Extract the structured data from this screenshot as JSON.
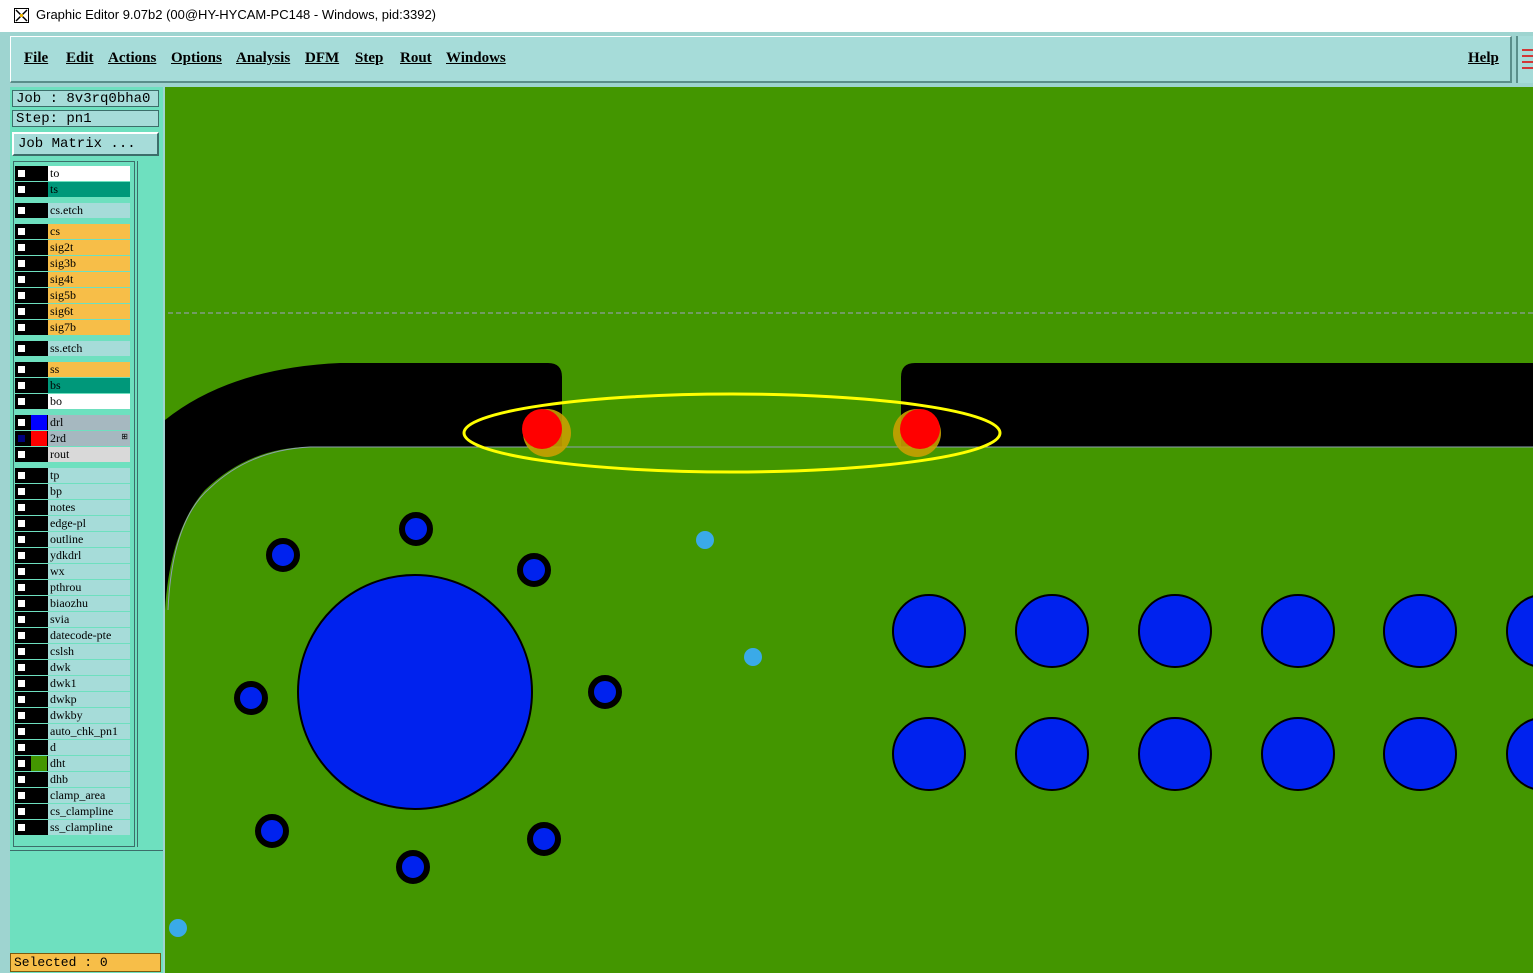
{
  "window": {
    "title": "Graphic Editor 9.07b2 (00@HY-HYCAM-PC148 - Windows, pid:3392)"
  },
  "menu": {
    "items": [
      "File",
      "Edit",
      "Actions",
      "Options",
      "Analysis",
      "DFM",
      "Step",
      "Rout",
      "Windows"
    ],
    "help": "Help"
  },
  "job": {
    "label": "Job : 8v3rq0bha0",
    "step": "Step: pn1",
    "matrix_button": "Job Matrix ..."
  },
  "layers": [
    {
      "name": "to",
      "color": "#ffffff",
      "swatch": "#000000"
    },
    {
      "name": "ts",
      "color": "#00987a",
      "swatch": "#000000"
    },
    {
      "name": "cs.etch",
      "color": "#a6dcd9",
      "swatch": "#000000"
    },
    {
      "name": "cs",
      "color": "#f7be48",
      "swatch": "#000000"
    },
    {
      "name": "sig2t",
      "color": "#f7be48",
      "swatch": "#000000"
    },
    {
      "name": "sig3b",
      "color": "#f7be48",
      "swatch": "#000000"
    },
    {
      "name": "sig4t",
      "color": "#f7be48",
      "swatch": "#000000"
    },
    {
      "name": "sig5b",
      "color": "#f7be48",
      "swatch": "#000000"
    },
    {
      "name": "sig6t",
      "color": "#f7be48",
      "swatch": "#000000"
    },
    {
      "name": "sig7b",
      "color": "#f7be48",
      "swatch": "#000000"
    },
    {
      "name": "ss.etch",
      "color": "#a6dcd9",
      "swatch": "#000000"
    },
    {
      "name": "ss",
      "color": "#f7be48",
      "swatch": "#000000"
    },
    {
      "name": "bs",
      "color": "#00987a",
      "swatch": "#000000"
    },
    {
      "name": "bo",
      "color": "#ffffff",
      "swatch": "#000000"
    },
    {
      "name": "drl",
      "color": "#a6b8c0",
      "swatch": "#0000ff"
    },
    {
      "name": "2rd",
      "color": "#a6b8c0",
      "swatch": "#ff0000",
      "checked": true,
      "mark": "⊞"
    },
    {
      "name": "rout",
      "color": "#d9d9d9",
      "swatch": "#000000"
    },
    {
      "name": "tp",
      "color": "#a6dcd9",
      "swatch": "#000000"
    },
    {
      "name": "bp",
      "color": "#a6dcd9",
      "swatch": "#000000"
    },
    {
      "name": "notes",
      "color": "#a6dcd9",
      "swatch": "#000000"
    },
    {
      "name": "edge-pl",
      "color": "#a6dcd9",
      "swatch": "#000000"
    },
    {
      "name": "outline",
      "color": "#a6dcd9",
      "swatch": "#000000"
    },
    {
      "name": "ydkdrl",
      "color": "#a6dcd9",
      "swatch": "#000000"
    },
    {
      "name": "wx",
      "color": "#a6dcd9",
      "swatch": "#000000"
    },
    {
      "name": "pthrou",
      "color": "#a6dcd9",
      "swatch": "#000000"
    },
    {
      "name": "biaozhu",
      "color": "#a6dcd9",
      "swatch": "#000000"
    },
    {
      "name": "svia",
      "color": "#a6dcd9",
      "swatch": "#000000"
    },
    {
      "name": "datecode-pte",
      "color": "#a6dcd9",
      "swatch": "#000000"
    },
    {
      "name": "cslsh",
      "color": "#a6dcd9",
      "swatch": "#000000"
    },
    {
      "name": "dwk",
      "color": "#a6dcd9",
      "swatch": "#000000"
    },
    {
      "name": "dwk1",
      "color": "#a6dcd9",
      "swatch": "#000000"
    },
    {
      "name": "dwkp",
      "color": "#a6dcd9",
      "swatch": "#000000"
    },
    {
      "name": "dwkby",
      "color": "#a6dcd9",
      "swatch": "#000000"
    },
    {
      "name": "auto_chk_pn1",
      "color": "#a6dcd9",
      "swatch": "#000000"
    },
    {
      "name": "d",
      "color": "#a6dcd9",
      "swatch": "#000000"
    },
    {
      "name": "dht",
      "color": "#a6dcd9",
      "swatch": "#439600"
    },
    {
      "name": "dhb",
      "color": "#a6dcd9",
      "swatch": "#000000"
    },
    {
      "name": "clamp_area",
      "color": "#a6dcd9",
      "swatch": "#000000"
    },
    {
      "name": "cs_clampline",
      "color": "#a6dcd9",
      "swatch": "#000000"
    },
    {
      "name": "ss_clampline",
      "color": "#a6dcd9",
      "swatch": "#000000"
    }
  ],
  "status": {
    "selected": "Selected : 0"
  },
  "colors": {
    "board": "#439600",
    "copper": "#000000",
    "drill": "#0022ee",
    "highlight_red": "#ff0000",
    "highlight_orange": "#c8a000",
    "via_light": "#3aaae8",
    "annotation": "#ffff00"
  }
}
